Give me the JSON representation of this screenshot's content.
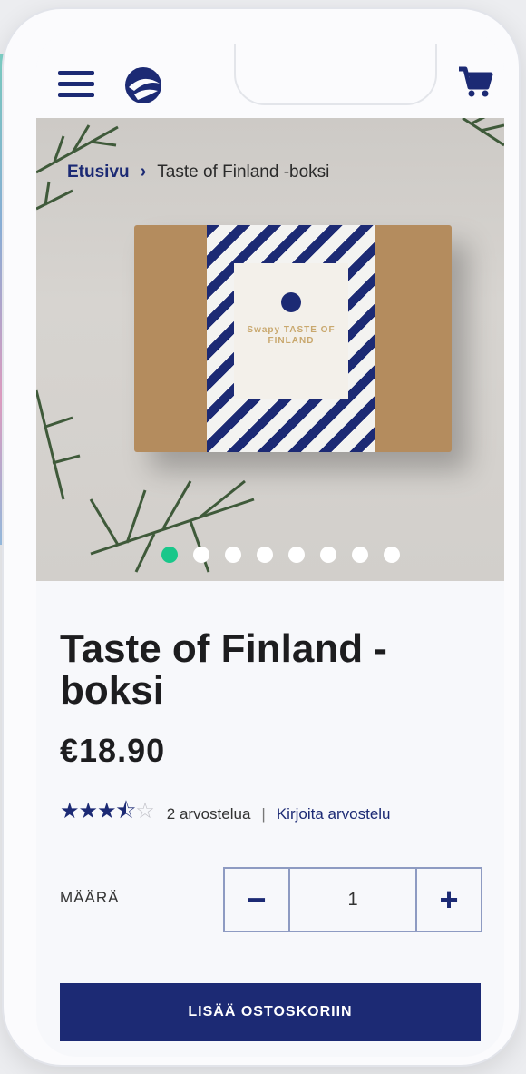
{
  "header": {
    "menu_icon": "hamburger-icon",
    "logo": "brand-logo",
    "cart_icon": "cart-icon"
  },
  "breadcrumb": {
    "home": "Etusivu",
    "current": "Taste of Finland -boksi"
  },
  "hero": {
    "box_label": "Swapy TASTE OF FINLAND",
    "slide_count": 8,
    "active_slide": 1
  },
  "product": {
    "title": "Taste of Finland - boksi",
    "price": "€18.90",
    "rating": 3.5,
    "rating_max": 5,
    "reviews": "2 arvostelua",
    "separator": "|",
    "write_review": "Kirjoita arvostelu"
  },
  "quantity": {
    "label": "MÄÄRÄ",
    "minus": "−",
    "value": "1",
    "plus": "+"
  },
  "add_to_cart": "LISÄÄ OSTOSKORIIN",
  "colors": {
    "primary": "#1c2a74",
    "active_dot": "#19c78a",
    "kraft": "#b48c5e"
  }
}
